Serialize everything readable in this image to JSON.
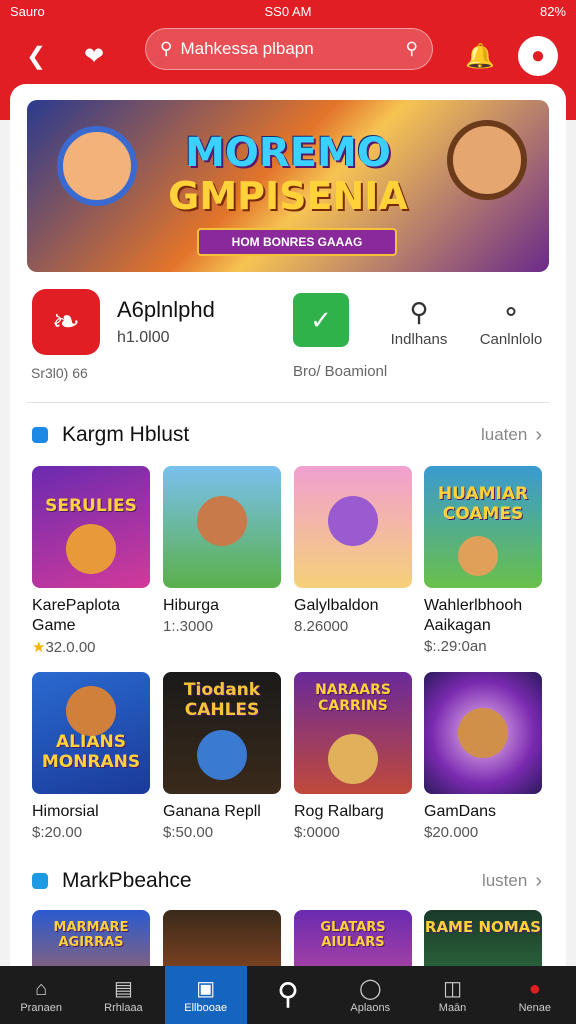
{
  "status": {
    "left": "Sauro",
    "time": "SS0 AM",
    "right": "82%"
  },
  "header": {
    "search_placeholder": "Mahkessa plbapn"
  },
  "banner": {
    "title_line1": "MOREMO",
    "title_line2": "GMPISENIA",
    "ribbon": "HOM BONRES GAAAG"
  },
  "app": {
    "name": "A6plnlphd",
    "price": "h1.0l00",
    "subtitle": "Sr3l0) 66",
    "install_label": "Bro/ Boamionl",
    "actions": [
      {
        "icon": "location-pin-icon",
        "label": "Indlhans"
      },
      {
        "icon": "share-icon",
        "label": "Canlnlolo"
      }
    ]
  },
  "section1": {
    "title": "Kargm Hblust",
    "more": "luaten",
    "items": [
      {
        "name": "KarePaplota Game",
        "price": "32.0.00",
        "rating": true,
        "art": "SERULIES"
      },
      {
        "name": "Hiburga",
        "price": "1:.3000",
        "art": ""
      },
      {
        "name": "Galylbaldon",
        "price": "8.26000",
        "art": ""
      },
      {
        "name": "Wahlerlbhooh Aaikagan",
        "price": "$:.29:0an",
        "art": "HUAMIAR COAMES"
      },
      {
        "name": "Himorsial",
        "price": "$:20.00",
        "art": "ALIANS MONRANS"
      },
      {
        "name": "Ganana Repll",
        "price": "$:50.00",
        "art": "Tiodank CAHLES"
      },
      {
        "name": "Rog Ralbarg",
        "price": "$:0000",
        "art": "NARAARS CARRINS"
      },
      {
        "name": "GamDans",
        "price": "$20.000",
        "art": ""
      }
    ]
  },
  "section2": {
    "title": "MarkPbeahce",
    "more": "lusten",
    "items": [
      {
        "art": "MARMARE AGIRRAS"
      },
      {
        "art": ""
      },
      {
        "art": "GLATARS AIULARS"
      },
      {
        "art": "RAME NOMAS"
      }
    ]
  },
  "nav": [
    {
      "icon": "home-icon",
      "label": "Pranaen"
    },
    {
      "icon": "store-icon",
      "label": "Rrhlaaa"
    },
    {
      "icon": "library-icon",
      "label": "Ellbooae",
      "active": true
    },
    {
      "icon": "search-icon",
      "label": ""
    },
    {
      "icon": "apps-icon",
      "label": "Aplaons"
    },
    {
      "icon": "games-icon",
      "label": "Maān"
    },
    {
      "icon": "profile-icon",
      "label": "Nenae"
    }
  ]
}
